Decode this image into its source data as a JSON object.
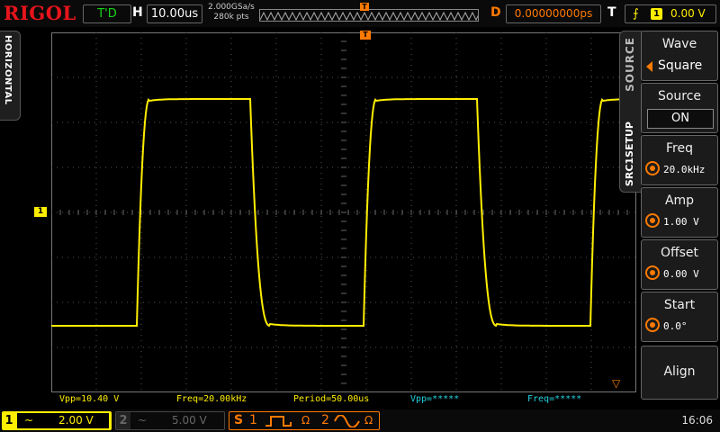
{
  "topbar": {
    "brand": "RIGOL",
    "trigger_status": "T'D",
    "horizontal_label": "H",
    "timebase": "10.00us",
    "sample_rate": "2.000GSa/s",
    "memory_depth": "280k pts",
    "delay_label": "D",
    "delay": "0.00000000ps",
    "trigger_label": "T",
    "trigger_source": "1",
    "trigger_level": "0.00 V"
  },
  "left_tab": {
    "label": "HORIZONTAL"
  },
  "screen": {
    "ch1_marker": "1",
    "trigger_marker": "T",
    "waveform": {
      "color": "#ffee00",
      "channel": "1",
      "shape": "square",
      "frequency_hz": 20000,
      "period_us": 50,
      "vpp_v": 10.4
    }
  },
  "measurements": [
    {
      "text": "Vpp=10.40 V",
      "color": "yellow"
    },
    {
      "text": "Freq=20.00kHz",
      "color": "yellow"
    },
    {
      "text": "Period=50.00us",
      "color": "yellow"
    },
    {
      "text": "Vpp=*****",
      "color": "cyan"
    },
    {
      "text": "Freq=*****",
      "color": "cyan"
    }
  ],
  "side_tab": {
    "main": "SOURCE",
    "sub": "SRC1SETUP"
  },
  "menu": {
    "wave": {
      "label": "Wave",
      "value": "Square"
    },
    "source": {
      "label": "Source",
      "value": "ON"
    },
    "freq": {
      "label": "Freq",
      "value": "20.0kHz"
    },
    "amp": {
      "label": "Amp",
      "value": "1.00 V"
    },
    "offset": {
      "label": "Offset",
      "value": "0.00 V"
    },
    "start": {
      "label": "Start",
      "value": "0.0°"
    },
    "align": {
      "label": "Align"
    }
  },
  "bottombar": {
    "ch1": {
      "num": "1",
      "coupling": "~",
      "scale": "2.00 V"
    },
    "ch2": {
      "num": "2",
      "coupling": "~",
      "scale": "5.00 V"
    },
    "source": {
      "letter": "S",
      "src1": "1",
      "src1_impedance": "Ω",
      "src2": "2",
      "src2_impedance": "Ω"
    },
    "time": "16:06"
  },
  "colors": {
    "accent": "#ff7a00",
    "ch1": "#ffee00",
    "measure_cyan": "#22d3e0",
    "brand_red": "#e8141b",
    "trigger_green": "#15d615"
  }
}
